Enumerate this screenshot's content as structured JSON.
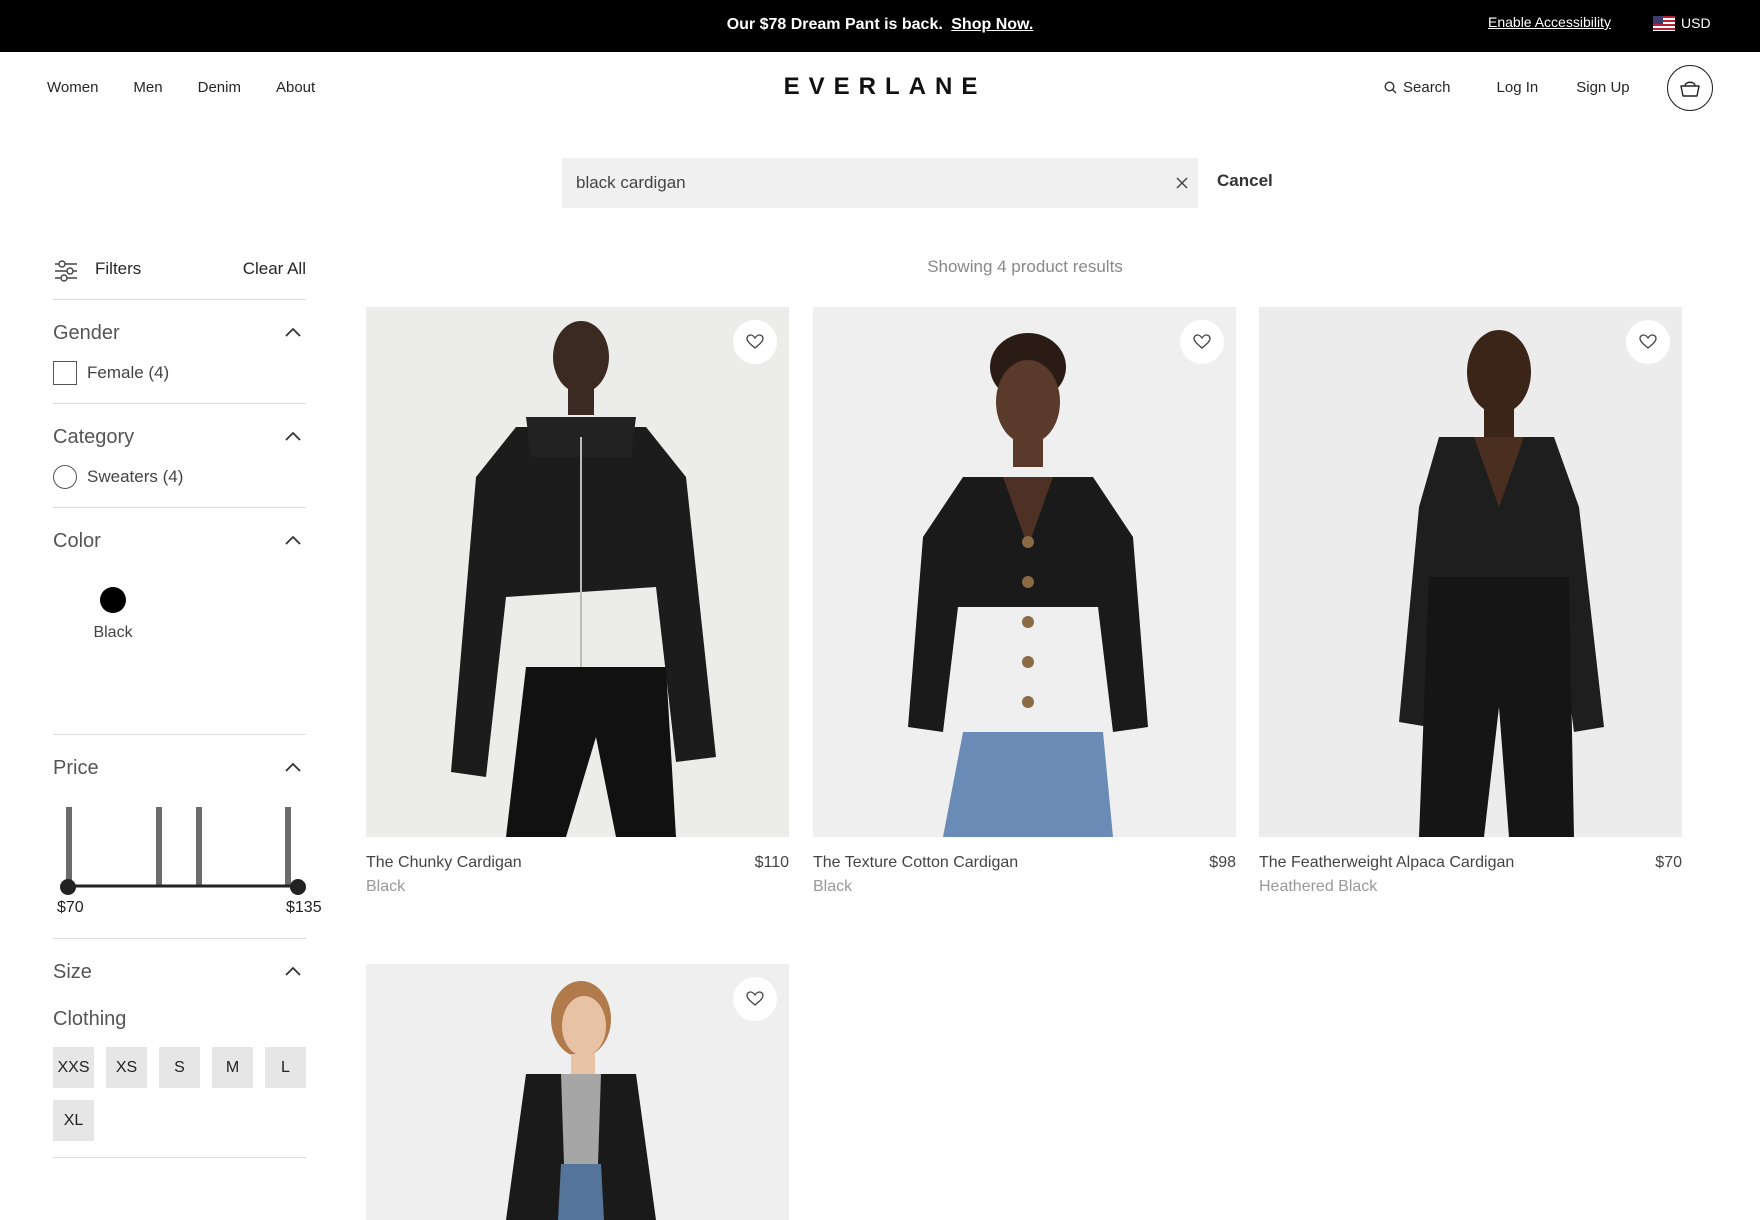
{
  "announcement": {
    "text": "Our $78 Dream Pant is back.",
    "link": "Shop Now.",
    "accessibility": "Enable Accessibility",
    "currency": "USD"
  },
  "nav": {
    "links": [
      "Women",
      "Men",
      "Denim",
      "About"
    ],
    "logo": "EVERLANE",
    "search": "Search",
    "login": "Log In",
    "signup": "Sign Up"
  },
  "search": {
    "value": "black cardigan",
    "cancel": "Cancel"
  },
  "filters": {
    "title": "Filters",
    "clear_all": "Clear All",
    "gender": {
      "title": "Gender",
      "option": "Female (4)"
    },
    "category": {
      "title": "Category",
      "option": "Sweaters (4)"
    },
    "color": {
      "title": "Color",
      "option": "Black",
      "swatch": "#000000"
    },
    "price": {
      "title": "Price",
      "min": "$70",
      "max": "$135"
    },
    "size": {
      "title": "Size",
      "subtitle": "Clothing",
      "options": [
        "XXS",
        "XS",
        "S",
        "M",
        "L",
        "XL"
      ]
    }
  },
  "results": {
    "count_text": "Showing 4 product results",
    "products": [
      {
        "name": "The Chunky Cardigan",
        "price": "$110",
        "color": "Black"
      },
      {
        "name": "The Texture Cotton Cardigan",
        "price": "$98",
        "color": "Black"
      },
      {
        "name": "The Featherweight Alpaca Cardigan",
        "price": "$70",
        "color": "Heathered Black"
      },
      {
        "name": "",
        "price": "",
        "color": ""
      }
    ]
  }
}
